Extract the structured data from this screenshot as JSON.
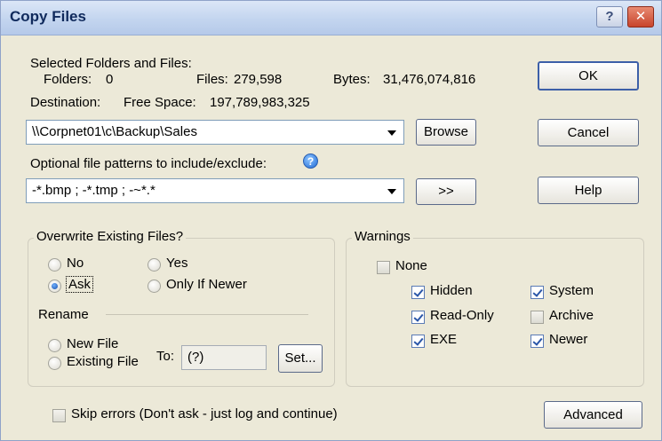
{
  "window": {
    "title": "Copy Files",
    "help_glyph": "?",
    "close_glyph": "✕"
  },
  "selection": {
    "heading": "Selected Folders and Files:",
    "folders_label": "Folders:",
    "folders_value": "0",
    "files_label": "Files:",
    "files_value": "279,598",
    "bytes_label": "Bytes:",
    "bytes_value": "31,476,074,816"
  },
  "destination": {
    "label": "Destination:",
    "free_space_label": "Free Space:",
    "free_space_value": "197,789,983,325",
    "path": "\\\\Corpnet01\\c\\Backup\\Sales",
    "browse_label": "Browse"
  },
  "patterns": {
    "label": "Optional file patterns to include/exclude:",
    "value": "-*.bmp ; -*.tmp ; -~*.*",
    "expand_label": ">>"
  },
  "buttons": {
    "ok": "OK",
    "cancel": "Cancel",
    "help": "Help",
    "advanced": "Advanced"
  },
  "overwrite": {
    "title": "Overwrite Existing Files?",
    "no": "No",
    "yes": "Yes",
    "ask": "Ask",
    "only_if_newer": "Only If Newer",
    "selected": "ask"
  },
  "rename": {
    "title": "Rename",
    "new_file": "New File",
    "existing_file": "Existing File",
    "to_label": "To:",
    "to_value": "(?)",
    "set_label": "Set..."
  },
  "warnings": {
    "title": "Warnings",
    "none": "None",
    "hidden": "Hidden",
    "system": "System",
    "read_only": "Read-Only",
    "archive": "Archive",
    "exe": "EXE",
    "newer": "Newer",
    "checked": [
      "hidden",
      "system",
      "read_only",
      "exe",
      "newer"
    ]
  },
  "skip_errors_label": "Skip errors (Don't ask - just log and continue)"
}
